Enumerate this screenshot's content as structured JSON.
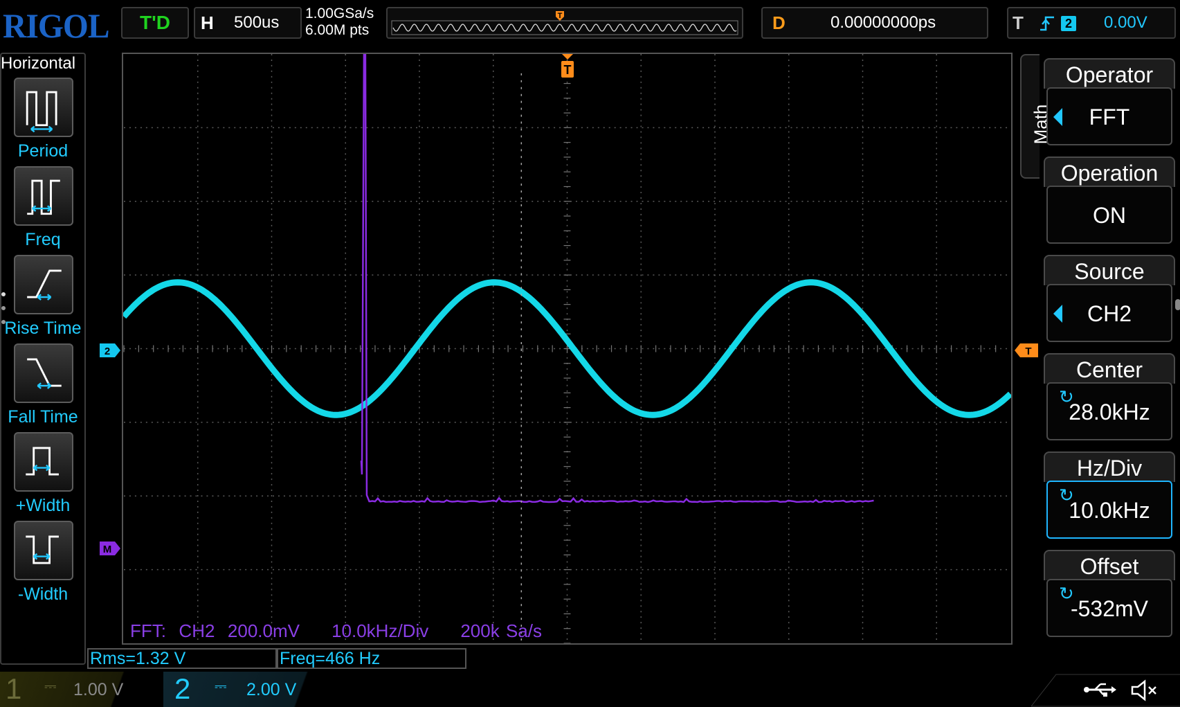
{
  "brand": "RIGOL",
  "status": {
    "run_state": "T'D",
    "horizontal": {
      "label": "H",
      "timebase": "500us"
    },
    "sample_rate": "1.00GSa/s",
    "memory_depth": "6.00M pts",
    "trigger_marker": "T",
    "delay": {
      "label": "D",
      "value": "0.00000000ps"
    },
    "trigger": {
      "label": "T",
      "source": "2",
      "level": "0.00V"
    }
  },
  "measure_panel": {
    "title": "Horizontal",
    "items": [
      {
        "label": "Period",
        "icon": "period-icon"
      },
      {
        "label": "Freq",
        "icon": "freq-icon"
      },
      {
        "label": "Rise Time",
        "icon": "rise-time-icon"
      },
      {
        "label": "Fall Time",
        "icon": "fall-time-icon"
      },
      {
        "label": "+Width",
        "icon": "pos-width-icon"
      },
      {
        "label": "-Width",
        "icon": "neg-width-icon"
      }
    ]
  },
  "markers": {
    "ch2": "2",
    "math": "M",
    "trigger_level": "T",
    "trigger_pos": "T"
  },
  "math_menu": {
    "tab": "Math",
    "buttons": [
      {
        "title": "Operator",
        "value": "FFT",
        "control": "arrow"
      },
      {
        "title": "Operation",
        "value": "ON",
        "control": "none"
      },
      {
        "title": "Source",
        "value": "CH2",
        "control": "arrow"
      },
      {
        "title": "Center",
        "value": "28.0kHz",
        "control": "knob"
      },
      {
        "title": "Hz/Div",
        "value": "10.0kHz",
        "control": "knob"
      },
      {
        "title": "Offset",
        "value": "-532mV",
        "control": "knob"
      }
    ]
  },
  "fft_info": "FFT:  CH2  200.0mV     10.0kHz/Div     200k Sa/s",
  "readouts": {
    "rms": "Rms=1.32 V",
    "freq": "Freq=466 Hz"
  },
  "channels": [
    {
      "num": "1",
      "coupling": "DC",
      "scale": "1.00 V",
      "color": "#6b6b3a"
    },
    {
      "num": "2",
      "coupling": "DC",
      "scale": "2.00 V",
      "color": "#22ccff"
    }
  ],
  "colors": {
    "ch2": "#14d8e8",
    "math": "#8a2be2",
    "trigger": "#ff8c1a",
    "accent": "#22c8ff"
  },
  "waveform": {
    "type": "sine",
    "cycles_visible": 2.8,
    "amplitude_div": 0.9,
    "fft_peak_x_div": 3.25
  }
}
